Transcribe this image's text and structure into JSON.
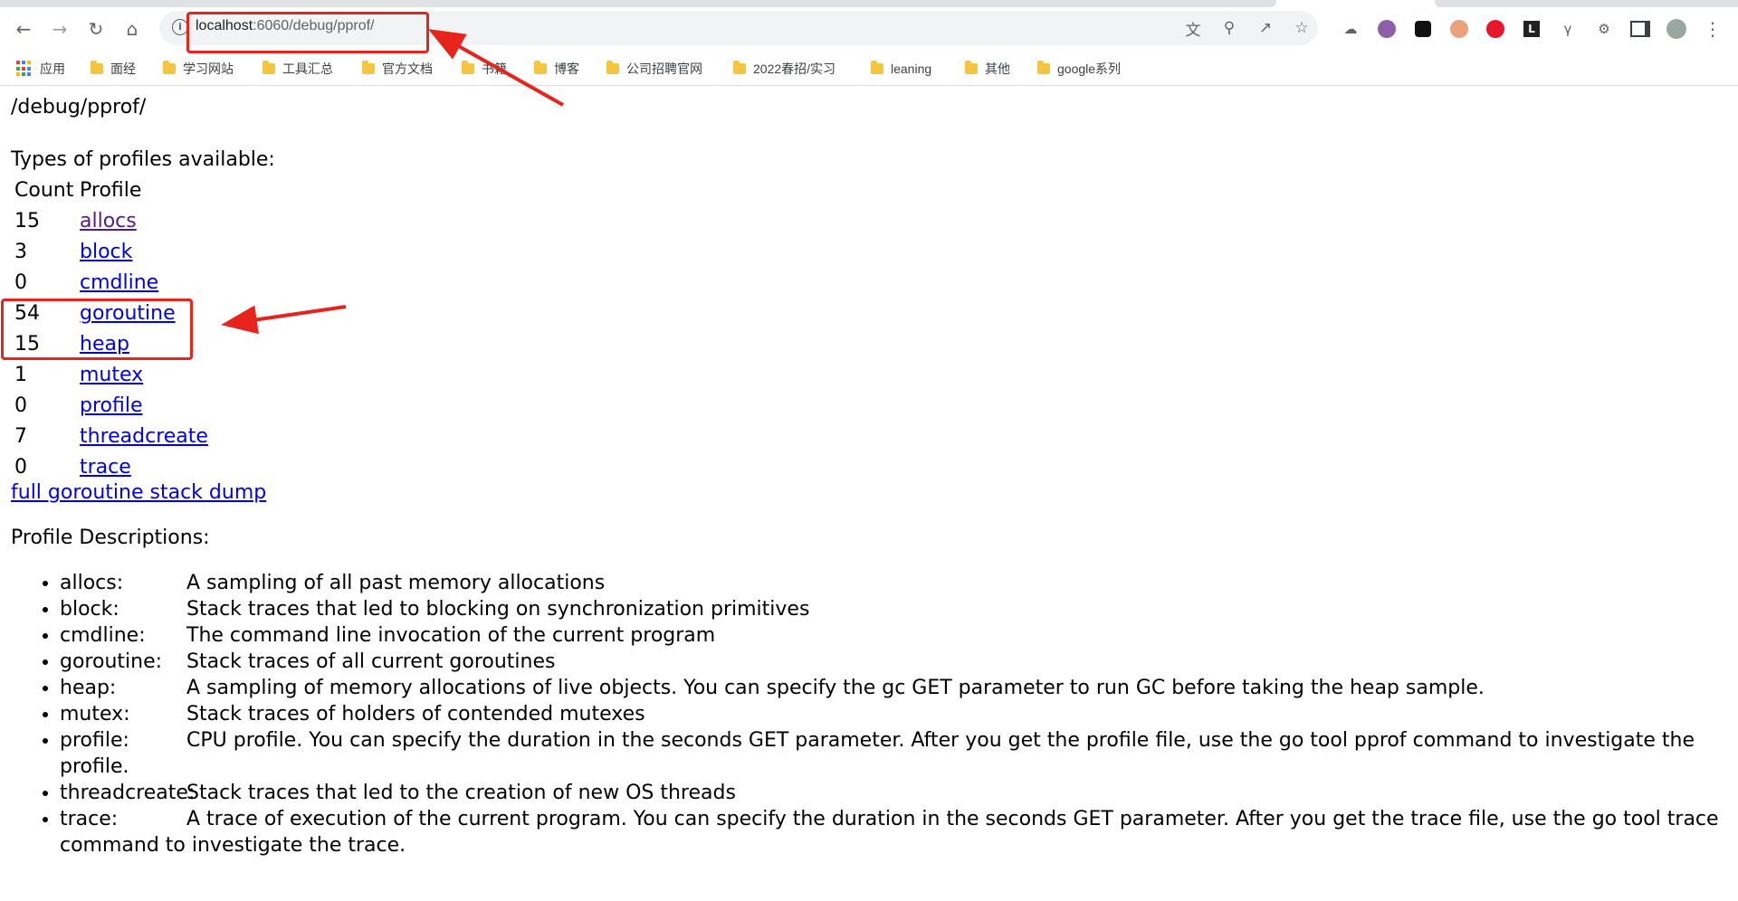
{
  "browser": {
    "url_host": "localhost",
    "url_rest": ":6060/debug/pprof/",
    "nav_icons": [
      "back-arrow-icon",
      "forward-arrow-icon",
      "reload-icon",
      "home-icon"
    ],
    "omnibox_icons": [
      "translate-icon",
      "zoom-icon",
      "share-icon",
      "star-icon"
    ],
    "extension_icons": [
      "cloud-ext-icon",
      "purple-ext-icon",
      "tampermonkey-ext-icon",
      "avatar-ext-icon",
      "weibo-ext-icon",
      "leetcode-ext-icon",
      "yapi-ext-icon",
      "puzzle-icon",
      "sidepanel-icon",
      "profile-avatar-icon",
      "more-menu-icon"
    ]
  },
  "bookmarks": {
    "apps_label": "应用",
    "items": [
      "面经",
      "学习网站",
      "工具汇总",
      "官方文档",
      "书籍",
      "博客",
      "公司招聘官网",
      "2022春招/实习",
      "leaning",
      "其他",
      "google系列"
    ]
  },
  "page": {
    "heading": "/debug/pprof/",
    "types_heading": "Types of profiles available:",
    "col_count": "Count",
    "col_profile": "Profile",
    "profiles": [
      {
        "count": "15",
        "name": "allocs"
      },
      {
        "count": "3",
        "name": "block"
      },
      {
        "count": "0",
        "name": "cmdline"
      },
      {
        "count": "54",
        "name": "goroutine"
      },
      {
        "count": "15",
        "name": "heap"
      },
      {
        "count": "1",
        "name": "mutex"
      },
      {
        "count": "0",
        "name": "profile"
      },
      {
        "count": "7",
        "name": "threadcreate"
      },
      {
        "count": "0",
        "name": "trace"
      }
    ],
    "full_dump_link": "full goroutine stack dump",
    "desc_heading": "Profile Descriptions:",
    "descriptions": [
      {
        "key": "allocs:",
        "text": "A sampling of all past memory allocations"
      },
      {
        "key": "block:",
        "text": "Stack traces that led to blocking on synchronization primitives"
      },
      {
        "key": "cmdline:",
        "text": "The command line invocation of the current program"
      },
      {
        "key": "goroutine:",
        "text": "Stack traces of all current goroutines"
      },
      {
        "key": "heap:",
        "text": "A sampling of memory allocations of live objects. You can specify the gc GET parameter to run GC before taking the heap sample."
      },
      {
        "key": "mutex:",
        "text": "Stack traces of holders of contended mutexes"
      },
      {
        "key": "profile:",
        "text": "CPU profile. You can specify the duration in the seconds GET parameter. After you get the profile file, use the go tool pprof command to investigate the profile."
      },
      {
        "key": "threadcreate:",
        "text": "Stack traces that led to the creation of new OS threads"
      },
      {
        "key": "trace:",
        "text": "A trace of execution of the current program. You can specify the duration in the seconds GET parameter. After you get the trace file, use the go tool trace command to investigate the trace."
      }
    ]
  },
  "colors": {
    "link": "#0000ee",
    "visited_link": "#551a8b",
    "annotation": "#e8231c"
  }
}
